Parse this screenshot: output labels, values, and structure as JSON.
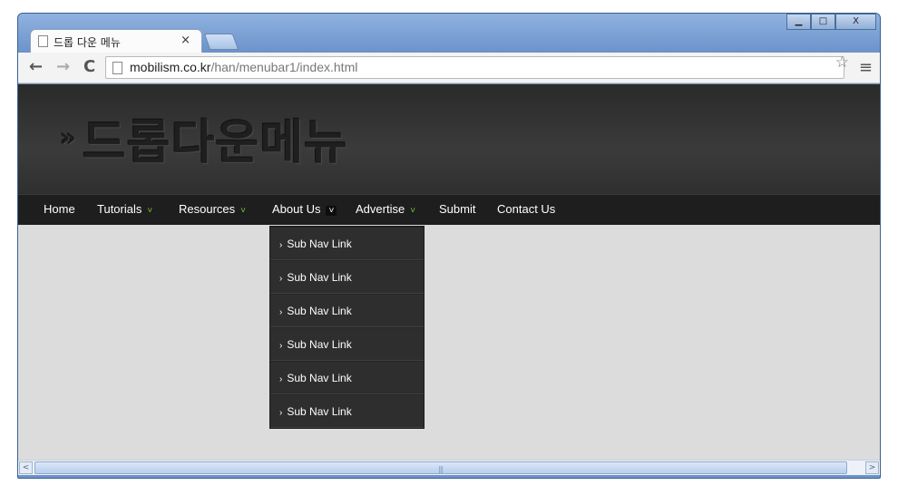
{
  "browser": {
    "tab_title": "드롭 다운 메뉴",
    "tab_close": "×",
    "window_buttons": [
      "▁",
      "□",
      "X"
    ],
    "back_label": "←",
    "forward_label": "→",
    "reload_label": "C",
    "url_host": "mobilism.co.kr",
    "url_path": "/han/menubar1/index.html",
    "star_icon": "☆",
    "menu_icon": "≡"
  },
  "page": {
    "header_icon": "»",
    "header_title": "드롭다운메뉴",
    "nav": {
      "items": [
        {
          "label": "Home",
          "has_arrow": false
        },
        {
          "label": "Tutorials",
          "has_arrow": true
        },
        {
          "label": "Resources",
          "has_arrow": true
        },
        {
          "label": "About Us",
          "has_arrow": true,
          "active": true
        },
        {
          "label": "Advertise",
          "has_arrow": true
        },
        {
          "label": "Submit",
          "has_arrow": false
        },
        {
          "label": "Contact Us",
          "has_arrow": false
        }
      ],
      "arrow_glyph": "˅"
    },
    "dropdown": {
      "items": [
        "Sub Nav Link",
        "Sub Nav Link",
        "Sub Nav Link",
        "Sub Nav Link",
        "Sub Nav Link",
        "Sub Nav Link"
      ],
      "bullet": "›"
    }
  },
  "scrollbar": {
    "left_arrow": "<",
    "right_arrow": ">",
    "grip": "|||"
  },
  "colors": {
    "accent_arrow": "#7ec13a",
    "navbar_bg": "#1e1e1e",
    "dropdown_bg": "#2e2e2e",
    "content_bg": "#dcdcdc"
  }
}
